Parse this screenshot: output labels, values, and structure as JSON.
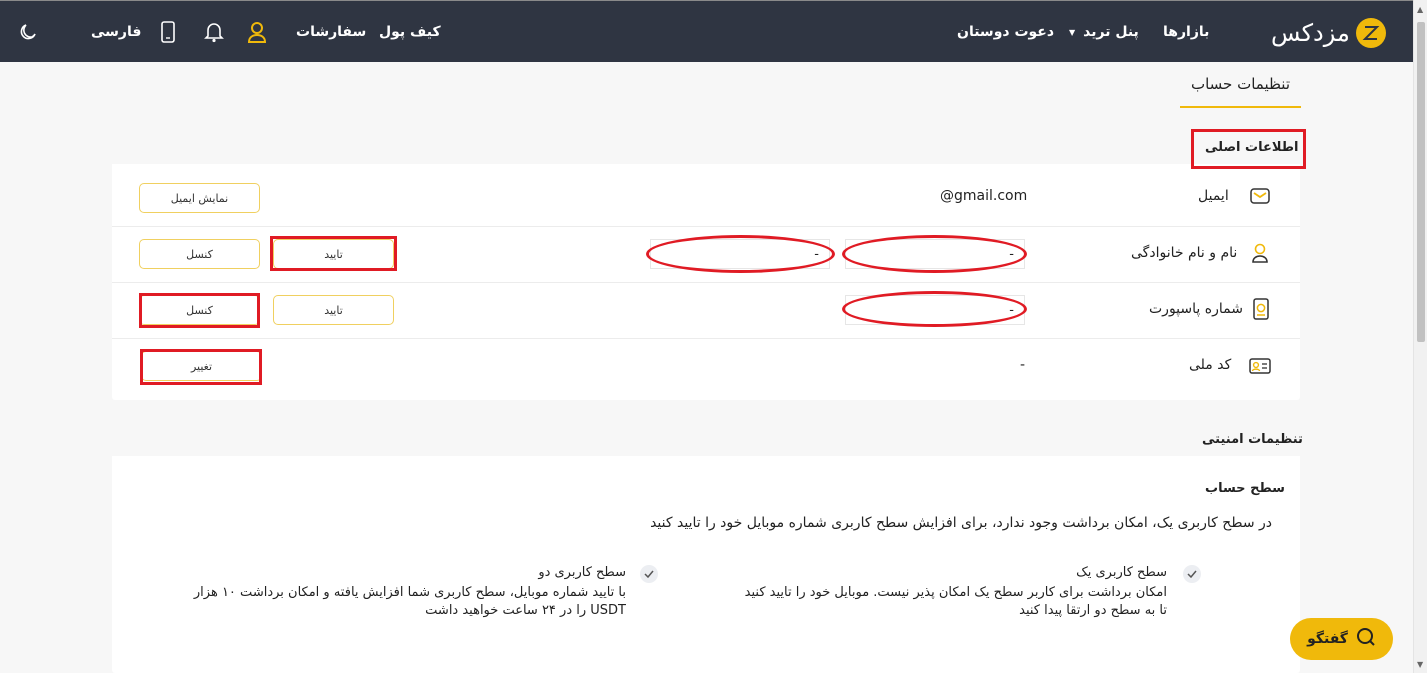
{
  "nav": {
    "brand": "مزدکس",
    "markets": "بازارها",
    "trade_panel": "پنل ترید",
    "trade_caret": "▼",
    "invite": "دعوت دوستان",
    "wallet": "کیف پول",
    "orders": "سفارشات",
    "language": "فارسی"
  },
  "tab": {
    "account_settings": "تنظیمات حساب"
  },
  "main_info": {
    "title": "اطلاعات اصلی",
    "email": {
      "label": "ایمیل",
      "value": "@gmail.com",
      "button": "نمایش ایمیل"
    },
    "name": {
      "label": "نام و نام خانوادگی",
      "first_value": "-",
      "last_value": "-",
      "confirm": "تایید",
      "cancel": "کنسل"
    },
    "passport": {
      "label": "شماره پاسپورت",
      "value": "-",
      "confirm": "تایید",
      "cancel": "کنسل"
    },
    "national_code": {
      "label": "کد ملی",
      "value": "-",
      "change": "تغییر"
    }
  },
  "security": {
    "title": "تنظیمات امنیتی",
    "level_title": "سطح حساب",
    "level_desc": "در سطح کاربری یک، امکان برداشت وجود ندارد، برای افزایش سطح کاربری شماره موبایل خود را تایید کنید",
    "level_one": {
      "title": "سطح کاربری یک",
      "line1": "امکان برداشت برای کاربر سطح یک امکان پذیر نیست. موبایل خود را تایید کنید",
      "line2": "تا به سطح دو ارتقا پیدا کنید"
    },
    "level_two": {
      "title": "سطح کاربری دو",
      "line1": "با تایید شماره موبایل، سطح کاربری شما افزایش یافته و امکان برداشت ۱۰ هزار",
      "line2": "USDT را در ۲۴ ساعت خواهید داشت"
    }
  },
  "chat": {
    "label": "گفتگو"
  },
  "colors": {
    "accent": "#f0b90b",
    "navbar": "#2f3542",
    "annotation": "#e01b24"
  }
}
